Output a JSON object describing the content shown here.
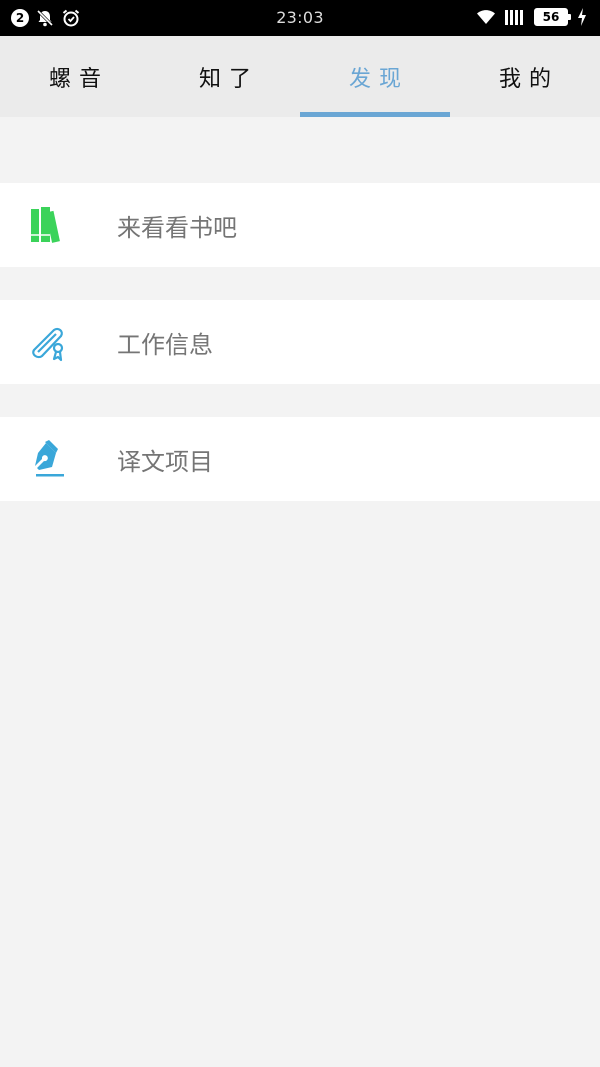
{
  "status_bar": {
    "notification_count": "2",
    "time": "23:03",
    "battery_level": "56",
    "icons": [
      "notification-badge-icon",
      "bell-off-icon",
      "alarm-icon",
      "wifi-icon",
      "signal-icon",
      "battery-icon",
      "charging-icon"
    ]
  },
  "tabs": [
    {
      "label": "螺音",
      "active": false
    },
    {
      "label": "知了",
      "active": false
    },
    {
      "label": "发现",
      "active": true
    },
    {
      "label": "我的",
      "active": false
    }
  ],
  "menu": {
    "items": [
      {
        "label": "来看看书吧",
        "icon": "books-icon",
        "icon_color": "#3bd35a"
      },
      {
        "label": "工作信息",
        "icon": "diploma-icon",
        "icon_color": "#3aa7d9"
      },
      {
        "label": "译文项目",
        "icon": "pen-nib-icon",
        "icon_color": "#3aa7d9"
      }
    ]
  },
  "colors": {
    "accent": "#6aa6d4",
    "background": "#f3f3f3",
    "tabbar": "#ebebeb",
    "status_bar": "#000000"
  }
}
